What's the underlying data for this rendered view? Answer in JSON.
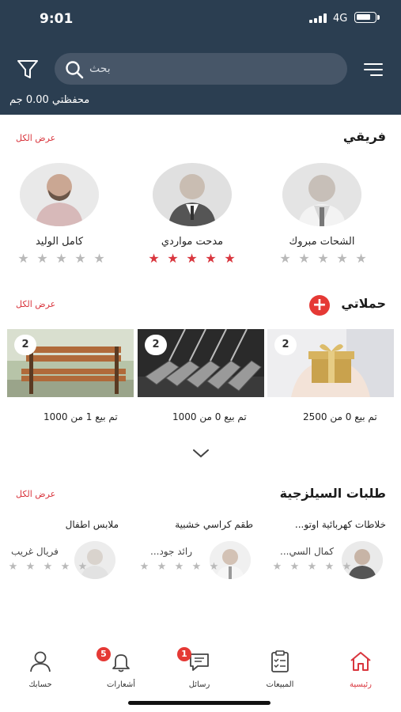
{
  "status_bar": {
    "time": "9:01",
    "network": "4G"
  },
  "header": {
    "search": {
      "placeholder": "بحث",
      "icon": "search-icon"
    },
    "filter_icon": "filter-icon",
    "menu_icon": "menu-icon",
    "wallet": "محفظتي 0.00 جم"
  },
  "team": {
    "title": "فريقي",
    "view_all": "عرض الكل",
    "members": [
      {
        "name": "الشحات مبروك",
        "rating": 0
      },
      {
        "name": "مدحت مواردي",
        "rating": 5
      },
      {
        "name": "كامل الوليد",
        "rating": 0
      }
    ]
  },
  "campaigns": {
    "title": "حملاتي",
    "view_all": "عرض الكل",
    "add_label": "+",
    "items": [
      {
        "count": "2",
        "sold": "تم بيع 0 من 2500",
        "image": "gift-box"
      },
      {
        "count": "2",
        "sold": "تم بيع 0 من 1000",
        "image": "golf-clubs"
      },
      {
        "count": "2",
        "sold": "تم بيع 1 من 1000",
        "image": "wooden-bench"
      }
    ]
  },
  "requests": {
    "title": "طلبات السيلزجية",
    "view_all": "عرض الكل",
    "items": [
      {
        "title": "خلاطات كهربائية اوتو...",
        "person": "كمال السي...",
        "rating": 0
      },
      {
        "title": "طقم كراسي خشبية",
        "person": "رائد جود...",
        "rating": 0
      },
      {
        "title": "ملابس اطفال",
        "person": "فريال غريب",
        "rating": 0
      }
    ]
  },
  "bottom_nav": {
    "tabs": [
      {
        "label": "رئيسية",
        "icon": "home-icon",
        "active": true
      },
      {
        "label": "المبيعات",
        "icon": "clipboard-icon",
        "active": false
      },
      {
        "label": "رسائل",
        "icon": "chat-icon",
        "active": false,
        "badge": "1"
      },
      {
        "label": "أشعارات",
        "icon": "bell-icon",
        "active": false,
        "badge": "5"
      },
      {
        "label": "حسابك",
        "icon": "user-icon",
        "active": false
      }
    ]
  },
  "colors": {
    "header_bg": "#2b3e51",
    "accent": "#d9363e",
    "star_off": "#b9b9b9"
  }
}
